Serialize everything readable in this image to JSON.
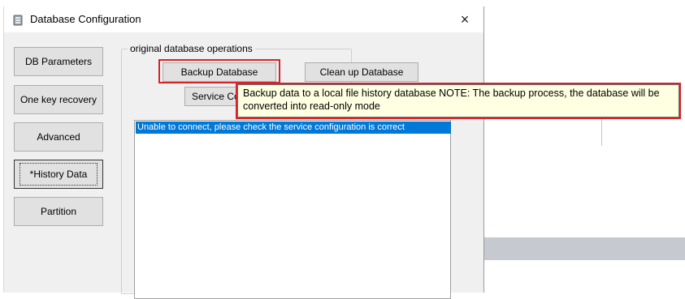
{
  "window": {
    "title": "Database Configuration",
    "close_glyph": "×",
    "icon": "database-config-icon"
  },
  "sidebar": {
    "items": [
      {
        "label": "DB Parameters"
      },
      {
        "label": "One key recovery"
      },
      {
        "label": "Advanced"
      },
      {
        "label": "*History Data"
      },
      {
        "label": "Partition"
      }
    ]
  },
  "group": {
    "title": "original database operations",
    "backup_label": "Backup Database",
    "cleanup_label": "Clean up Database",
    "service_label": "Service Con"
  },
  "list": {
    "items": [
      "Unable to connect, please check the service configuration is correct"
    ]
  },
  "tooltip": {
    "text": "Backup data to a local file history database NOTE: The backup process, the database will be converted into read-only mode"
  },
  "colors": {
    "highlight_red": "#d9222a",
    "selection_blue": "#0078d7",
    "tooltip_bg": "#ffffe1"
  }
}
